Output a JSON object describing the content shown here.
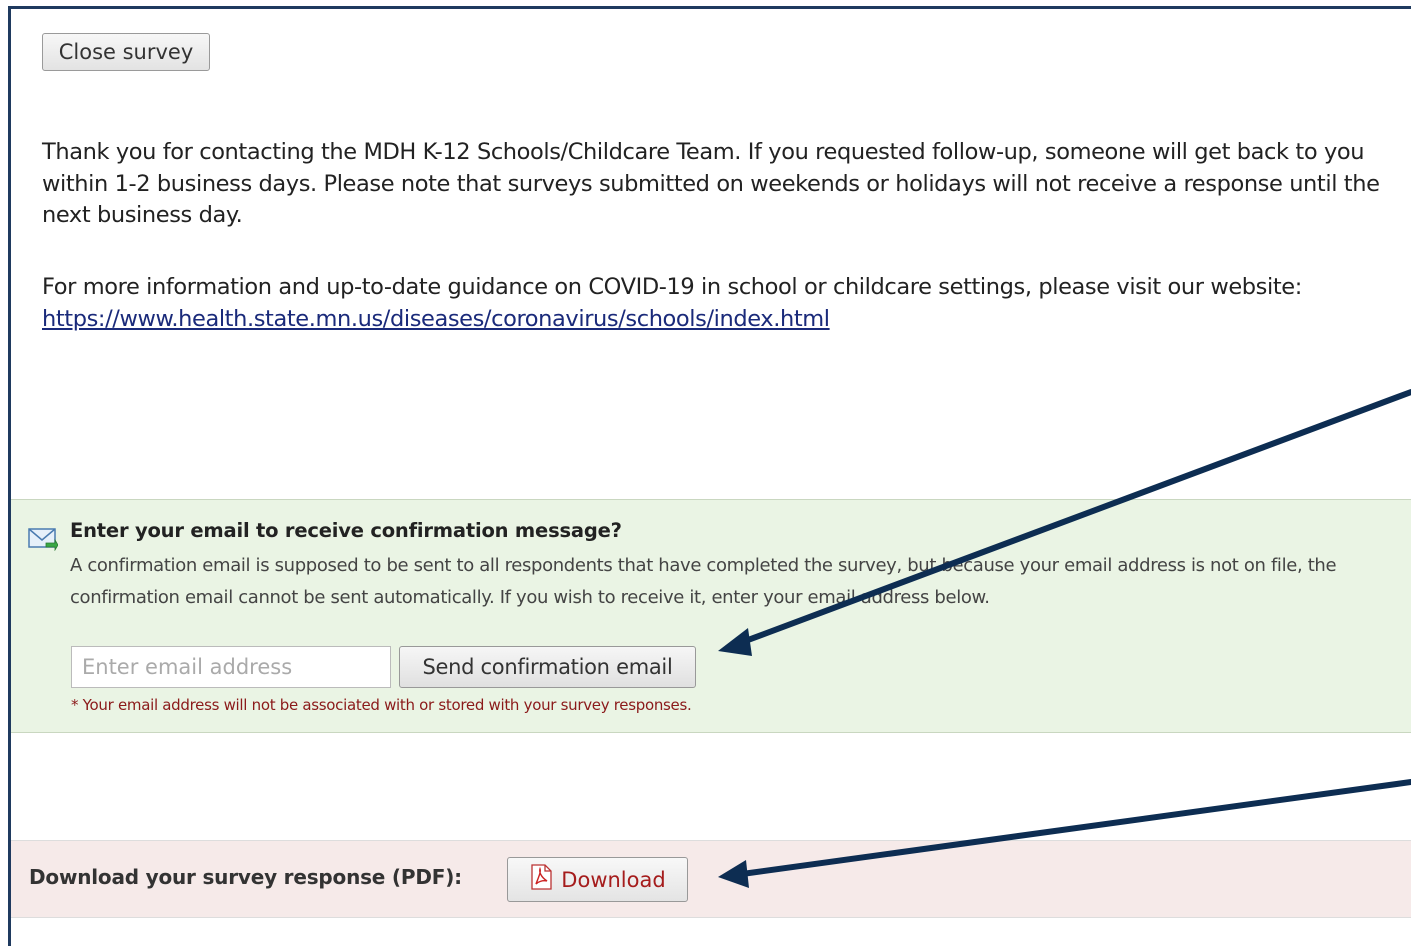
{
  "close_button": {
    "label": "Close survey"
  },
  "message": {
    "paragraph1": "Thank you for contacting the MDH K-12 Schools/Childcare Team. If you requested follow-up, someone will get back to you within 1-2 business days. Please note that surveys submitted on weekends or holidays will not receive a response until the next business day.",
    "paragraph2_text": "For more information and up-to-date guidance on COVID-19 in school or childcare settings, please visit our website:",
    "link": "https://www.health.state.mn.us/diseases/coronavirus/schools/index.html"
  },
  "email_section": {
    "icon": "mail-icon",
    "title": "Enter your email to receive confirmation message?",
    "description": "A confirmation email is supposed to be sent to all respondents that have completed the survey, but because your email address is not on file, the confirmation email cannot be sent automatically. If you wish to receive it, enter your email address below.",
    "input_value": "",
    "input_placeholder": "Enter email address",
    "send_button": "Send confirmation email",
    "note": "* Your email address will not be associated with or stored with your survey responses.",
    "background": "#eaf4e4"
  },
  "download_section": {
    "label": "Download your survey response (PDF):",
    "button": "Download",
    "icon": "pdf-icon",
    "background": "#f6eae9"
  },
  "annotation_arrows": {
    "color": "#0d2d52",
    "count": 2
  }
}
